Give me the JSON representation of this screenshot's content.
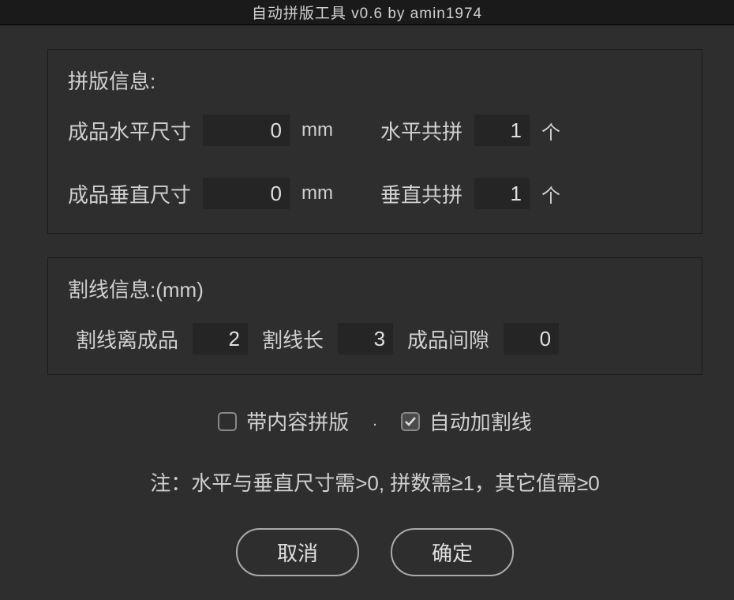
{
  "titlebar": "自动拼版工具 v0.6   by amin1974",
  "group1": {
    "title": "拼版信息:",
    "horizSizeLabel": "成品水平尺寸",
    "horizSizeValue": "0",
    "horizSizeUnit": "mm",
    "horizCountLabel": "水平共拼",
    "horizCountValue": "1",
    "horizCountUnit": "个",
    "vertSizeLabel": "成品垂直尺寸",
    "vertSizeValue": "0",
    "vertSizeUnit": "mm",
    "vertCountLabel": "垂直共拼",
    "vertCountValue": "1",
    "vertCountUnit": "个"
  },
  "group2": {
    "title": "割线信息:(mm)",
    "cutOffsetLabel": "割线离成品",
    "cutOffsetValue": "2",
    "cutLengthLabel": "割线长",
    "cutLengthValue": "3",
    "gapLabel": "成品间隙",
    "gapValue": "0"
  },
  "checks": {
    "withContentLabel": "带内容拼版",
    "withContentChecked": false,
    "separator": ".",
    "autoCutLabel": "自动加割线",
    "autoCutChecked": true
  },
  "note": "注：水平与垂直尺寸需>0, 拼数需≥1，其它值需≥0",
  "buttons": {
    "cancel": "取消",
    "ok": "确定"
  }
}
